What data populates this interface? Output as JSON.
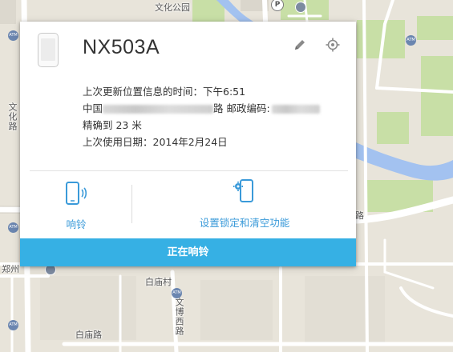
{
  "device": {
    "name": "NX503A",
    "location_updated": "上次更新位置信息的时间：下午6:51",
    "address_prefix": "中国",
    "address_mid": "路 邮政编码:",
    "accuracy": "精确到 23 米",
    "last_used": "上次使用日期：2014年2月24日"
  },
  "actions": {
    "ring_label": "响铃",
    "lock_label": "设置锁定和清空功能",
    "ringing_status": "正在响铃"
  },
  "icons": {
    "edit": "pencil-icon",
    "locate": "crosshair-icon",
    "ring": "phone-ringing-icon",
    "lock": "phone-gear-icon"
  },
  "map": {
    "labels": {
      "park": "文化公园",
      "wenhua_road": "文化路",
      "road_suffix": "路",
      "zhengzhou": "郑州",
      "baimiao_village": "白庙村",
      "wenbo_west_road": "文博西路",
      "baimiao_road": "白庙路"
    },
    "atm_label": "ATM",
    "parking_label": "P"
  },
  "colors": {
    "accent": "#36b0e4",
    "link": "#3a9ad9",
    "water": "#a3c2f0",
    "park": "#c8dfa6",
    "road": "#ffffff"
  }
}
